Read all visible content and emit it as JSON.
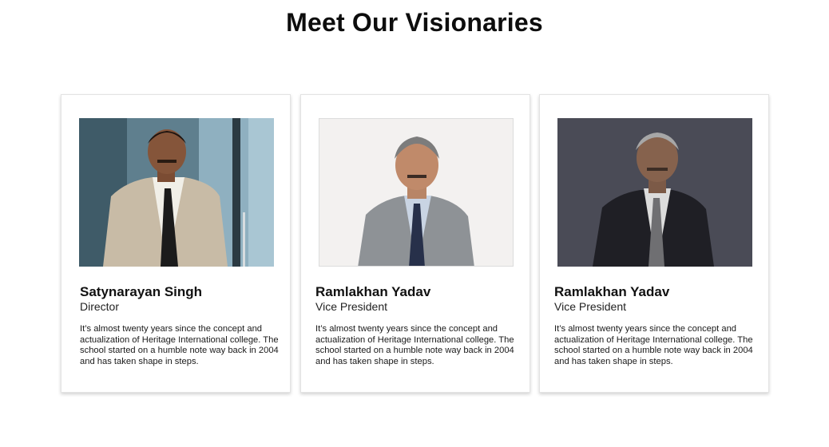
{
  "section": {
    "title": "Meet Our Visionaries"
  },
  "cards": [
    {
      "name": "Satynarayan Singh",
      "role": "Director",
      "description": "It’s almost twenty years since the concept and actualization of Heritage International college. The school started on a humble note way back in 2004 and has taken shape in steps.",
      "photo_icon": "portrait-photo"
    },
    {
      "name": "Ramlakhan Yadav",
      "role": "Vice President",
      "description": "It’s almost twenty years since the concept and actualization of Heritage International college. The school started on a humble note way back in 2004 and has taken shape in steps.",
      "photo_icon": "portrait-photo"
    },
    {
      "name": "Ramlakhan Yadav",
      "role": "Vice President",
      "description": "It’s almost twenty years since the concept and actualization of Heritage International college. The school started on a humble note way back in 2004 and has taken shape in steps.",
      "photo_icon": "portrait-photo"
    }
  ],
  "colors": {
    "background": "#ffffff",
    "card_border": "#e3e3e3",
    "text": "#111111"
  }
}
